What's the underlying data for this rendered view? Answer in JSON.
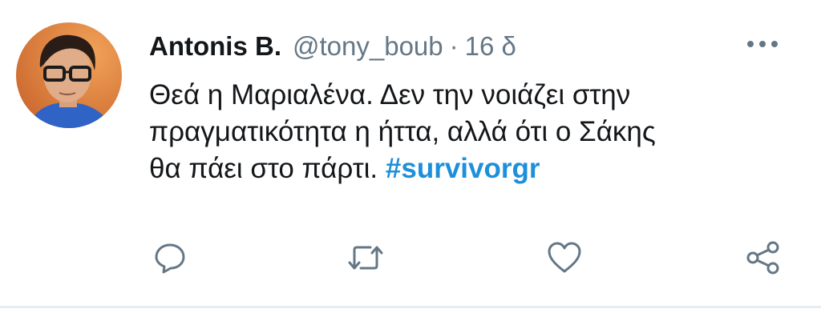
{
  "tweet": {
    "author_name": "Antonis B.",
    "handle": "@tony_boub",
    "separator": "·",
    "time": "16 δ",
    "text_lines": [
      "Θεά η Μαριαλένα. Δεν την νοιάζει στην",
      "πραγματικότητα η ήττα, αλλά ότι ο Σάκης",
      "θα πάει στο πάρτι."
    ],
    "hashtag": "#survivorgr"
  },
  "icons": {
    "avatar": "profile-photo",
    "more": "more-horizontal-icon",
    "reply": "reply-bubble-icon",
    "retweet": "retweet-icon",
    "like": "heart-icon",
    "share": "share-icon"
  },
  "colors": {
    "name": "#14171a",
    "secondary": "#657786",
    "hashtag": "#1d8fdb",
    "divider": "#e6ecf0"
  }
}
